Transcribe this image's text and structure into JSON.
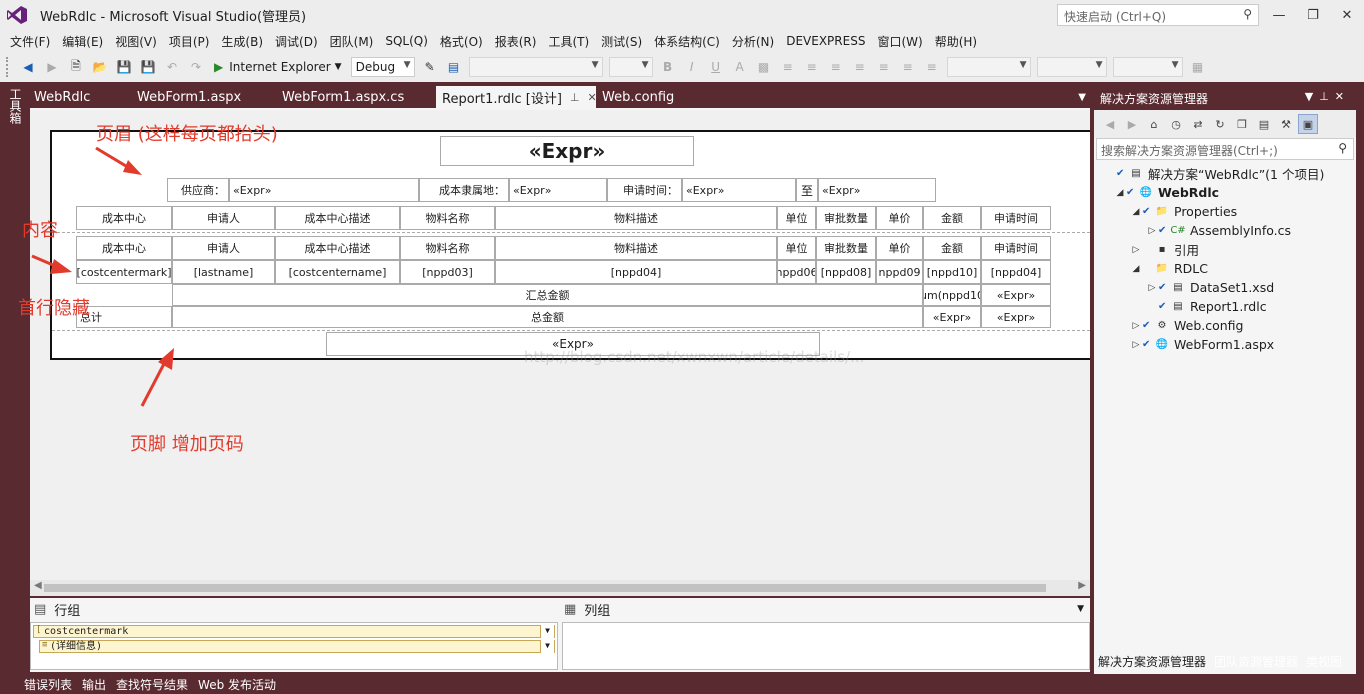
{
  "window": {
    "title": "WebRdlc - Microsoft Visual Studio(管理员)",
    "quick_launch_placeholder": "快速启动 (Ctrl+Q)"
  },
  "menu": [
    "文件(F)",
    "编辑(E)",
    "视图(V)",
    "项目(P)",
    "生成(B)",
    "调试(D)",
    "团队(M)",
    "SQL(Q)",
    "格式(O)",
    "报表(R)",
    "工具(T)",
    "测试(S)",
    "体系结构(C)",
    "分析(N)",
    "DEVEXPRESS",
    "窗口(W)",
    "帮助(H)"
  ],
  "toolbar": {
    "run_target": "Internet Explorer",
    "configuration": "Debug"
  },
  "toolbox_label": "工具箱",
  "doc_tabs": [
    {
      "label": "WebRdlc",
      "active": false
    },
    {
      "label": "WebForm1.aspx",
      "active": false
    },
    {
      "label": "WebForm1.aspx.cs",
      "active": false
    },
    {
      "label": "Report1.rdlc [设计]",
      "active": true
    },
    {
      "label": "Web.config",
      "active": false
    }
  ],
  "report": {
    "header_title": "«Expr»",
    "header_fields": {
      "supplier_label": "供应商：",
      "supplier_value": "«Expr»",
      "cost_label": "成本隶属地：",
      "cost_value": "«Expr»",
      "apply_time_label": "申请时间：",
      "apply_time_from": "«Expr»",
      "to_label": "至",
      "apply_time_to": "«Expr»"
    },
    "header_columns": [
      "成本中心",
      "申请人",
      "成本中心描述",
      "物料名称",
      "物料描述",
      "单位",
      "审批数量",
      "单价",
      "金额",
      "申请时间"
    ],
    "body_columns": [
      "成本中心",
      "申请人",
      "成本中心描述",
      "物料名称",
      "物料描述",
      "单位",
      "审批数量",
      "单价",
      "金额",
      "申请时间"
    ],
    "detail_row": [
      "[costcentermark]",
      "[lastname]",
      "[costcentername]",
      "[nppd03]",
      "[nppd04]",
      "nppd06",
      "[nppd08]",
      "nppd09",
      "[nppd10]",
      "[nppd04]"
    ],
    "subtotal_label": "汇总金额",
    "subtotal_value": "um(nppd10",
    "subtotal_expr": "«Expr»",
    "total_prefix": "总计",
    "total_label": "总金额",
    "total_expr1": "«Expr»",
    "total_expr2": "«Expr»",
    "footer_expr": "«Expr»"
  },
  "annotations": {
    "header_note": "页眉 (这样每页都抬头)",
    "content_note": "内容",
    "hide_note": "首行隐藏",
    "footer_note": "页脚 增加页码"
  },
  "watermark": "http://blog.csdn.net/xwnxwn/article/details/...",
  "grouping": {
    "row_groups_title": "行组",
    "column_groups_title": "列组",
    "row_group_items": [
      "costcentermark",
      "(详细信息)"
    ]
  },
  "status_bar": [
    "错误列表",
    "输出",
    "查找符号结果",
    "Web 发布活动"
  ],
  "solution_explorer": {
    "title": "解决方案资源管理器",
    "search_placeholder": "搜索解决方案资源管理器(Ctrl+;)",
    "tree": [
      {
        "label": "解决方案“WebRdlc”(1 个项目)",
        "level": 0,
        "icon": "solution-icon"
      },
      {
        "label": "WebRdlc",
        "level": 1,
        "icon": "web-project-icon",
        "bold": true
      },
      {
        "label": "Properties",
        "level": 2,
        "icon": "properties-folder-icon"
      },
      {
        "label": "AssemblyInfo.cs",
        "level": 3,
        "icon": "csharp-file-icon"
      },
      {
        "label": "引用",
        "level": 2,
        "icon": "references-icon"
      },
      {
        "label": "RDLC",
        "level": 2,
        "icon": "folder-icon"
      },
      {
        "label": "DataSet1.xsd",
        "level": 3,
        "icon": "dataset-icon"
      },
      {
        "label": "Report1.rdlc",
        "level": 3,
        "icon": "report-file-icon"
      },
      {
        "label": "Web.config",
        "level": 2,
        "icon": "config-file-icon"
      },
      {
        "label": "WebForm1.aspx",
        "level": 2,
        "icon": "aspx-file-icon"
      }
    ],
    "bottom_tabs": [
      {
        "label": "解决方案资源管理器",
        "active": true
      },
      {
        "label": "团队资源管理器",
        "active": false
      },
      {
        "label": "类视图",
        "active": false
      }
    ]
  }
}
